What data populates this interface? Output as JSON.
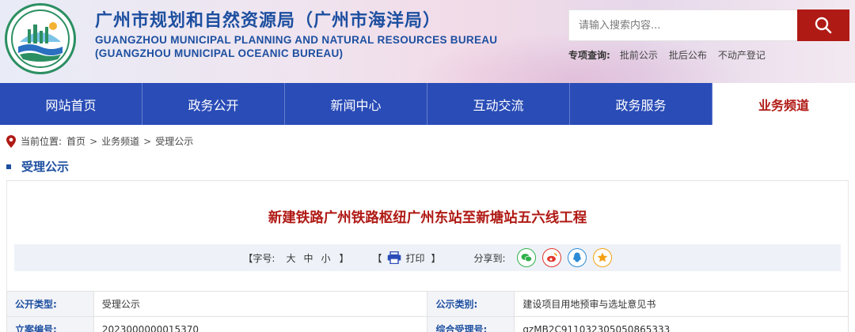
{
  "header": {
    "title_cn": "广州市规划和自然资源局（广州市海洋局）",
    "title_en_1": "GUANGZHOU MUNICIPAL PLANNING AND NATURAL RESOURCES BUREAU",
    "title_en_2": "(GUANGZHOU MUNICIPAL OCEANIC BUREAU)",
    "logo_text": "广州市规划和自然资源局"
  },
  "search": {
    "placeholder": "请输入搜索内容...",
    "icon": "search-icon"
  },
  "special_query": {
    "label": "专项查询:",
    "links": [
      "批前公示",
      "批后公布",
      "不动产登记"
    ]
  },
  "nav": {
    "items": [
      "网站首页",
      "政务公开",
      "新闻中心",
      "互动交流",
      "政务服务",
      "业务频道"
    ],
    "active": "业务频道"
  },
  "breadcrumb": {
    "prefix": "当前位置:",
    "items": [
      "首页",
      "业务频道",
      "受理公示"
    ],
    "separator": ">"
  },
  "section": {
    "title": "受理公示"
  },
  "article": {
    "title": "新建铁路广州铁路枢纽广州东站至新塘站五六线工程"
  },
  "toolbar": {
    "font_open": "【字号:",
    "font_large": "大",
    "font_medium": "中",
    "font_small": "小",
    "font_close": "】",
    "print_open": "【",
    "print_label": "打印",
    "print_close": "】",
    "share_label": "分享到:"
  },
  "info_table": {
    "rows": [
      {
        "k1": "公开类型:",
        "v1": "受理公示",
        "k2": "公示类别:",
        "v2": "建设项目用地预审与选址意见书"
      },
      {
        "k1": "立案编号:",
        "v1": "2023000000015370",
        "k2": "综合受理号:",
        "v2": "gzMB2C911032305050865333"
      }
    ]
  },
  "colors": {
    "brand_blue": "#1d4fa0",
    "nav_blue": "#2a4cb7",
    "accent_red": "#b01a15"
  }
}
